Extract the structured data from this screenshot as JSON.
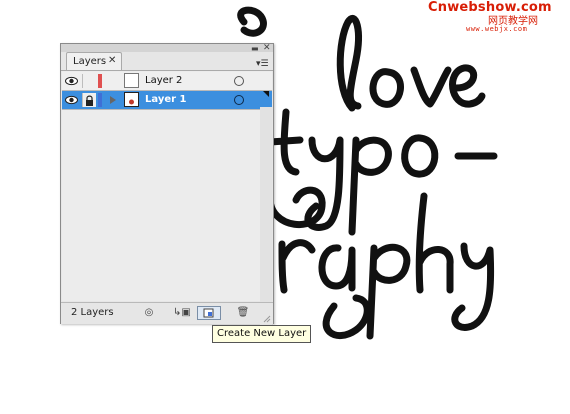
{
  "watermark": {
    "brand": "Cnwebshow.com",
    "subtitle": "网页教学网",
    "url": "www.webjx.com",
    "color": "#d81e06"
  },
  "artwork": {
    "lines": [
      "love",
      "typo-",
      "raphy"
    ]
  },
  "panel": {
    "tab_label": "Layers",
    "tab_close_icon": "close-icon",
    "menu_icon": "panel-menu-icon",
    "layers": [
      {
        "name": "Layer 2",
        "selected": false,
        "color": "#e05050",
        "locked": false,
        "visible": true
      },
      {
        "name": "Layer 1",
        "selected": true,
        "color": "#3f6fd6",
        "locked": true,
        "visible": true
      }
    ],
    "footer": {
      "count": "2 Layers",
      "buttons": [
        "make-clipping-mask-icon",
        "create-sublayer-icon",
        "create-new-layer-icon",
        "delete-layer-icon"
      ]
    }
  },
  "tooltip": "Create New Layer"
}
